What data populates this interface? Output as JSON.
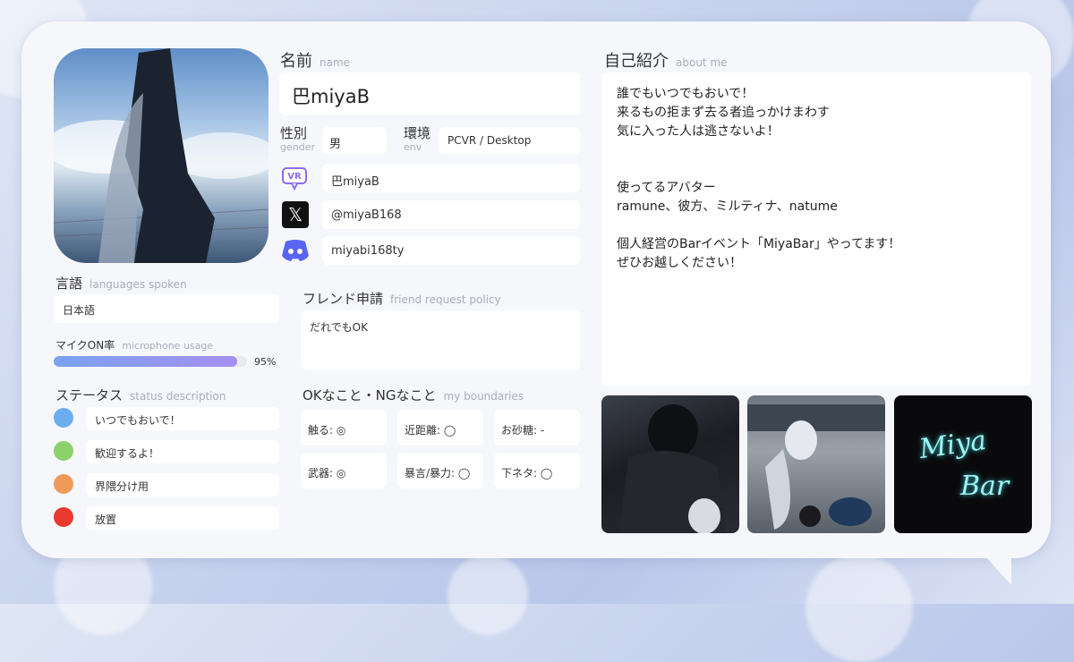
{
  "profile": {
    "photo_alt": "profile-photo",
    "name_label": "名前",
    "name_sub": "name",
    "name_value": "巴miyaB",
    "gender_label": "性別",
    "gender_sub": "gender",
    "gender_value": "男",
    "env_label": "環境",
    "env_sub": "env",
    "env_value": "PCVR / Desktop",
    "vrchat_id": "巴miyaB",
    "x_handle": "@miyaB168",
    "discord_id": "miyabi168ty"
  },
  "languages": {
    "label": "言語",
    "sub": "languages spoken",
    "value": "日本語"
  },
  "mic": {
    "label": "マイクON率",
    "sub": "microphone usage",
    "percent_text": "95%",
    "percent": 0.95
  },
  "status": {
    "label": "ステータス",
    "sub": "status description",
    "items": [
      {
        "color": "#6aaef0",
        "text": "いつでもおいで！"
      },
      {
        "color": "#8bd16a",
        "text": "歓迎するよ！"
      },
      {
        "color": "#f09a5a",
        "text": "界隈分け用"
      },
      {
        "color": "#e8392c",
        "text": "放置"
      }
    ]
  },
  "friend": {
    "label": "フレンド申請",
    "sub": "friend request policy",
    "value": "だれでもOK"
  },
  "boundaries": {
    "label": "OKなこと・NGなこと",
    "sub": "my boundaries",
    "items": [
      "触る: ◎",
      "近距離: ◯",
      "お砂糖: -",
      "武器: ◎",
      "暴言/暴力: ◯",
      "下ネタ: ◯"
    ]
  },
  "about": {
    "label": "自己紹介",
    "sub": "about me",
    "text": "誰でもいつでもおいで！\n来るもの拒まず去る者追っかけまわす\n気に入った人は逃さないよ！\n\n\n使ってるアバター\nramune、彼方、ミルティナ、natume\n\n個人経営のBarイベント「MiyaBar」やってます！\nぜひお越しください！"
  },
  "gallery": {
    "logo_line1": "Miya",
    "logo_line2": "Bar"
  },
  "icons": [
    "vrchat-icon",
    "x-icon",
    "discord-icon"
  ]
}
